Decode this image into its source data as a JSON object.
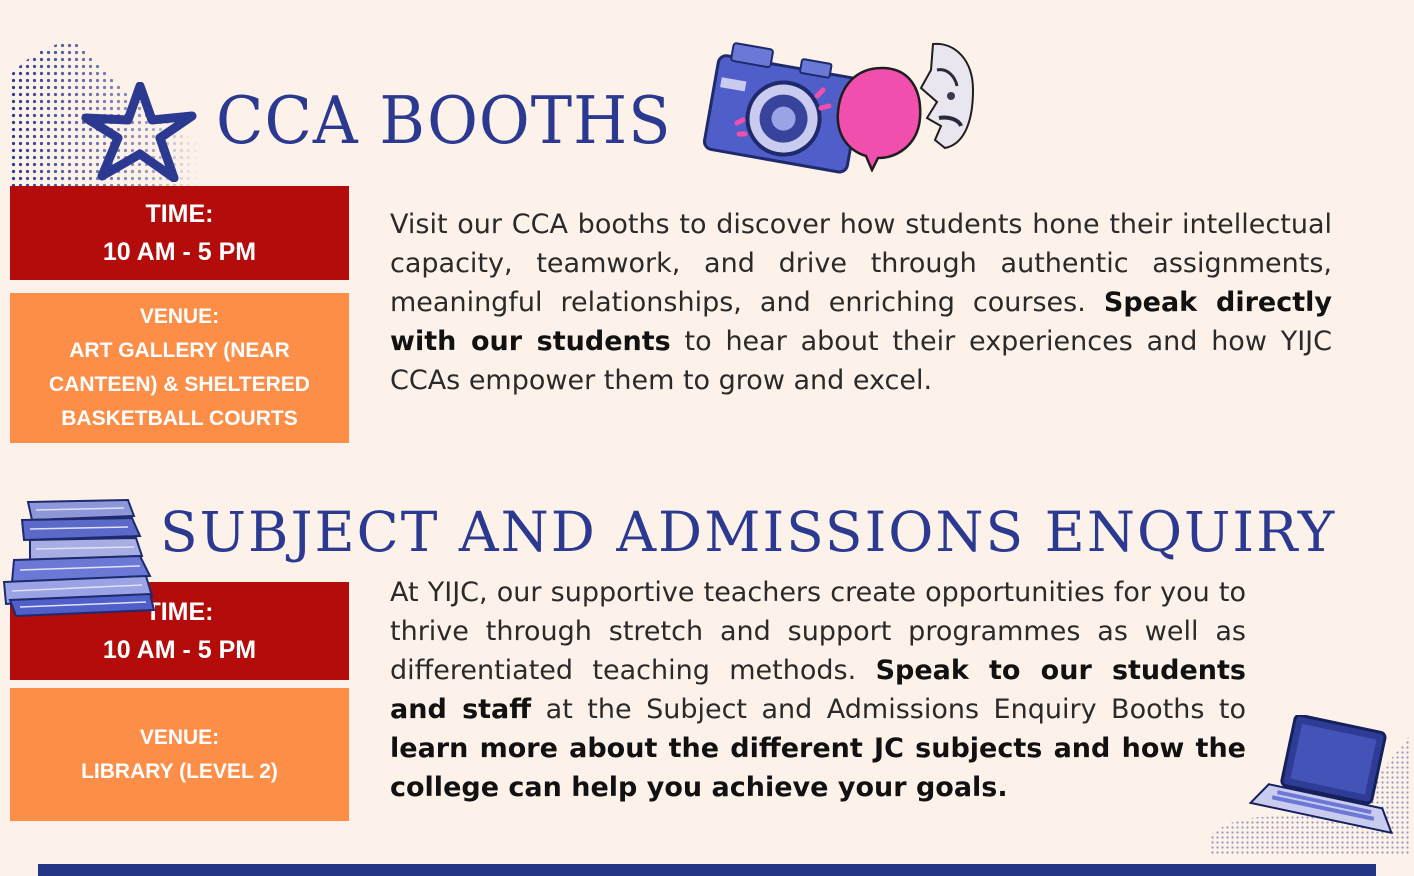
{
  "section1": {
    "title": "CCA BOOTHS",
    "time_label": "TIME:",
    "time_value": "10 AM - 5 PM",
    "venue_label": "VENUE:",
    "venue_lines": [
      "ART GALLERY (NEAR",
      "CANTEEN) & SHELTERED",
      "BASKETBALL COURTS"
    ],
    "para_a": "Visit our CCA booths to discover how students hone their intellectual capacity, teamwork, and drive through authentic assignments, meaningful relationships, and enriching courses. ",
    "para_bold": "Speak directly with our students",
    "para_b": " to hear about their experiences and how YIJC CCAs empower them to grow and excel."
  },
  "section2": {
    "title": "SUBJECT AND ADMISSIONS ENQUIRY",
    "time_label": "TIME:",
    "time_value": "10 AM - 5 PM",
    "venue_label": "VENUE:",
    "venue_value": "LIBRARY (LEVEL 2)",
    "para_a": "At YIJC, our supportive teachers create opportunities for you to thrive through stretch and support programmes as well as differentiated teaching methods. ",
    "para_bold1": "Speak to our students and staff",
    "para_b": " at the Subject and Admissions Enquiry Booths to ",
    "para_bold2": "learn more about the different JC subjects and how the college can help you achieve your goals."
  },
  "colors": {
    "background": "#fcf2ea",
    "title": "#2b3990",
    "time_box": "#b40b0b",
    "venue_box": "#fd8e48",
    "accent_pink": "#f04fae",
    "footer_bar": "#233584"
  },
  "icons": [
    "star-icon",
    "camera-icon",
    "speech-bubble-icon",
    "face-icon",
    "books-stack-icon",
    "laptop-icon"
  ]
}
